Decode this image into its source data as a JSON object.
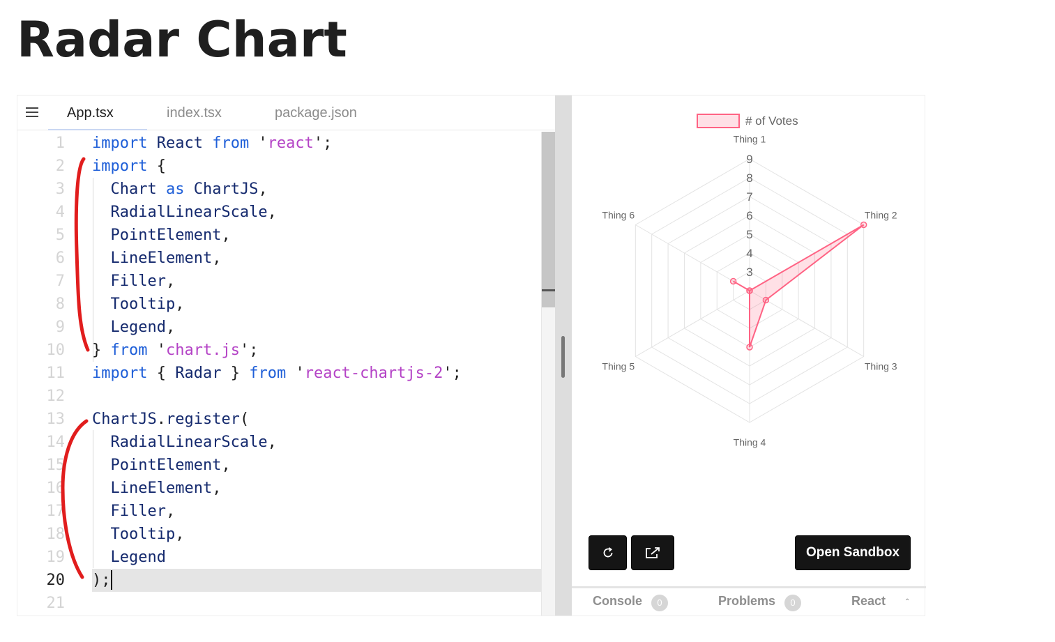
{
  "page": {
    "title": "Radar Chart"
  },
  "editor": {
    "menu_icon": "hamburger-icon",
    "tabs": [
      {
        "label": "App.tsx",
        "active": true
      },
      {
        "label": "index.tsx",
        "active": false
      },
      {
        "label": "package.json",
        "active": false
      }
    ],
    "current_line": 20,
    "lines": [
      {
        "n": "1",
        "tokens": [
          [
            "kw",
            "import"
          ],
          [
            "id",
            " React "
          ],
          [
            "kw",
            "from"
          ],
          [
            "pun",
            " '"
          ],
          [
            "str",
            "react"
          ],
          [
            "pun",
            "';"
          ]
        ]
      },
      {
        "n": "2",
        "tokens": [
          [
            "kw",
            "import"
          ],
          [
            "pun",
            " {"
          ]
        ]
      },
      {
        "n": "3",
        "tokens": [
          [
            "id",
            "  Chart "
          ],
          [
            "kw",
            "as"
          ],
          [
            "id",
            " ChartJS"
          ],
          [
            "pun",
            ","
          ]
        ]
      },
      {
        "n": "4",
        "tokens": [
          [
            "id",
            "  RadialLinearScale"
          ],
          [
            "pun",
            ","
          ]
        ]
      },
      {
        "n": "5",
        "tokens": [
          [
            "id",
            "  PointElement"
          ],
          [
            "pun",
            ","
          ]
        ]
      },
      {
        "n": "6",
        "tokens": [
          [
            "id",
            "  LineElement"
          ],
          [
            "pun",
            ","
          ]
        ]
      },
      {
        "n": "7",
        "tokens": [
          [
            "id",
            "  Filler"
          ],
          [
            "pun",
            ","
          ]
        ]
      },
      {
        "n": "8",
        "tokens": [
          [
            "id",
            "  Tooltip"
          ],
          [
            "pun",
            ","
          ]
        ]
      },
      {
        "n": "9",
        "tokens": [
          [
            "id",
            "  Legend"
          ],
          [
            "pun",
            ","
          ]
        ]
      },
      {
        "n": "10",
        "tokens": [
          [
            "pun",
            "} "
          ],
          [
            "kw",
            "from"
          ],
          [
            "pun",
            " '"
          ],
          [
            "str",
            "chart.js"
          ],
          [
            "pun",
            "';"
          ]
        ]
      },
      {
        "n": "11",
        "tokens": [
          [
            "kw",
            "import"
          ],
          [
            "pun",
            " { "
          ],
          [
            "id",
            "Radar"
          ],
          [
            "pun",
            " } "
          ],
          [
            "kw",
            "from"
          ],
          [
            "pun",
            " '"
          ],
          [
            "str",
            "react-chartjs-2"
          ],
          [
            "pun",
            "';"
          ]
        ]
      },
      {
        "n": "12",
        "tokens": []
      },
      {
        "n": "13",
        "tokens": [
          [
            "id",
            "ChartJS"
          ],
          [
            "pun",
            "."
          ],
          [
            "id",
            "register"
          ],
          [
            "pun",
            "("
          ]
        ]
      },
      {
        "n": "14",
        "tokens": [
          [
            "id",
            "  RadialLinearScale"
          ],
          [
            "pun",
            ","
          ]
        ]
      },
      {
        "n": "15",
        "tokens": [
          [
            "id",
            "  PointElement"
          ],
          [
            "pun",
            ","
          ]
        ]
      },
      {
        "n": "16",
        "tokens": [
          [
            "id",
            "  LineElement"
          ],
          [
            "pun",
            ","
          ]
        ]
      },
      {
        "n": "17",
        "tokens": [
          [
            "id",
            "  Filler"
          ],
          [
            "pun",
            ","
          ]
        ]
      },
      {
        "n": "18",
        "tokens": [
          [
            "id",
            "  Tooltip"
          ],
          [
            "pun",
            ","
          ]
        ]
      },
      {
        "n": "19",
        "tokens": [
          [
            "id",
            "  Legend"
          ]
        ]
      },
      {
        "n": "20",
        "tokens": [
          [
            "pun",
            ");"
          ]
        ]
      },
      {
        "n": "21",
        "tokens": []
      }
    ]
  },
  "preview": {
    "refresh_icon": "refresh-icon",
    "open_new_window_icon": "external-link-icon",
    "open_sandbox_label": "Open Sandbox",
    "bottom_tabs": [
      {
        "label": "Console",
        "count": "0"
      },
      {
        "label": "Problems",
        "count": "0"
      },
      {
        "label": "React"
      }
    ],
    "collapse_icon": "caret-up-icon"
  },
  "chart_data": {
    "type": "radar",
    "labels": [
      "Thing 1",
      "Thing 2",
      "Thing 3",
      "Thing 4",
      "Thing 5",
      "Thing 6"
    ],
    "series": [
      {
        "name": "# of Votes",
        "values": [
          2,
          9,
          3,
          5,
          2,
          3
        ],
        "color": "#ff6384",
        "fill": "rgba(255, 99, 132, 0.2)"
      }
    ],
    "r_ticks": [
      "3",
      "4",
      "5",
      "6",
      "7",
      "8",
      "9"
    ],
    "r_min": 2,
    "r_max": 9,
    "grid_color": "#e3e3e3",
    "legend_position": "top"
  }
}
